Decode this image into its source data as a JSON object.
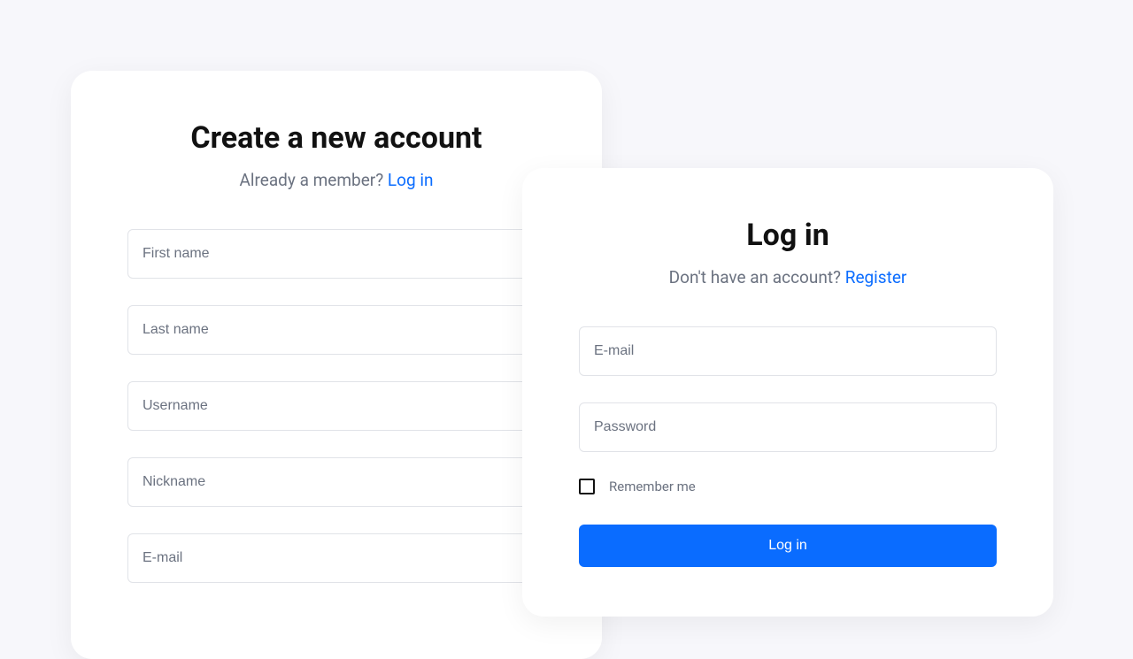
{
  "register": {
    "title": "Create a new account",
    "subtitle_prefix": "Already a member? ",
    "subtitle_link": "Log in",
    "fields": {
      "first_name": "First name",
      "last_name": "Last name",
      "username": "Username",
      "nickname": "Nickname",
      "email": "E-mail"
    }
  },
  "login": {
    "title": "Log in",
    "subtitle_prefix": "Don't have an account? ",
    "subtitle_link": "Register",
    "fields": {
      "email": "E-mail",
      "password": "Password"
    },
    "remember_label": "Remember me",
    "submit_label": "Log in"
  }
}
